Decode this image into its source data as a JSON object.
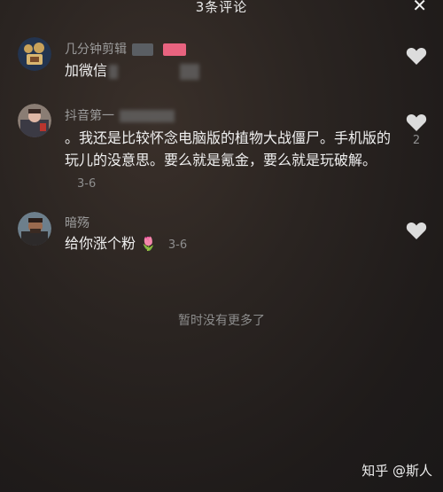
{
  "header": {
    "title": "3条评论",
    "close_icon": "close-icon"
  },
  "comments": [
    {
      "username": "几分钟剪辑",
      "text": "加微信",
      "date": "",
      "likes": ""
    },
    {
      "username": "抖音第一",
      "text": "。我还是比较怀念电脑版的植物大战僵尸。手机版的玩儿的没意思。要么就是氪金，要么就是玩破解。",
      "date": "3-6",
      "likes": "2"
    },
    {
      "username": "暗殇",
      "text": "给你涨个粉",
      "emoji": "🌷",
      "date": "3-6",
      "likes": ""
    }
  ],
  "end_text": "暂时没有更多了",
  "watermark": "知乎 @斯人",
  "colors": {
    "background": "#1e1c1b",
    "username": "#9c9c9c",
    "text": "#f0f0f0",
    "heart": "#dcdcdc"
  }
}
